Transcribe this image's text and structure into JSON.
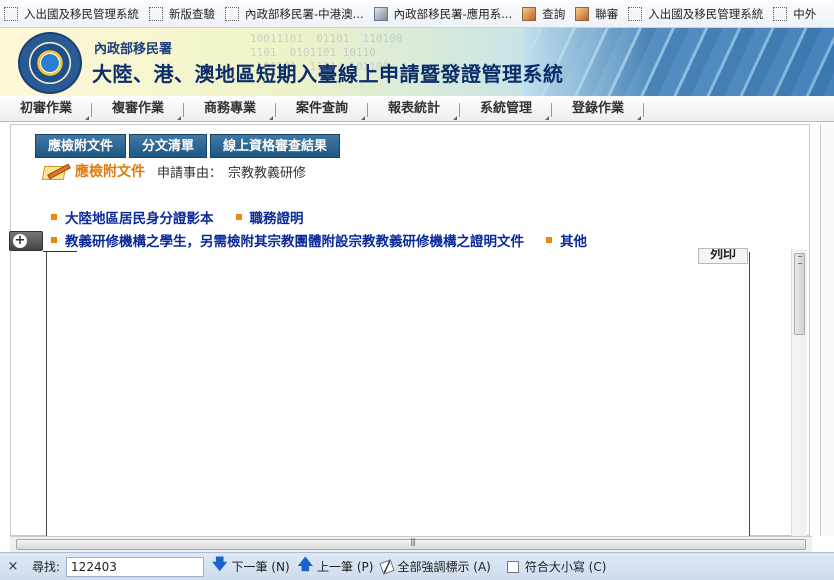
{
  "favorites": [
    {
      "label": "入出國及移民管理系統",
      "icon": "dotted-page-icon"
    },
    {
      "label": "新版查驗",
      "icon": "dotted-page-icon"
    },
    {
      "label": "內政部移民署-中港澳...",
      "icon": "dotted-page-icon"
    },
    {
      "label": "內政部移民署-應用系...",
      "icon": "app-image-icon"
    },
    {
      "label": "查詢",
      "icon": "app-image-icon"
    },
    {
      "label": "聯審",
      "icon": "app-image-icon"
    },
    {
      "label": "入出國及移民管理系統",
      "icon": "dotted-page-icon"
    },
    {
      "label": "中外",
      "icon": "dotted-page-icon"
    }
  ],
  "header": {
    "agency": "內政部移民署",
    "title": "大陸、港、澳地區短期入臺線上申請暨發證管理系統",
    "digits": "10011101  01101  110100\n1101  0101101 10110\n 101101  1101  101100"
  },
  "menu": [
    "初審作業",
    "複審作業",
    "商務專業",
    "案件查詢",
    "報表統計",
    "系統管理",
    "登錄作業"
  ],
  "tabs": [
    "應檢附文件",
    "分文清單",
    "線上資格審查結果"
  ],
  "request": {
    "title": "應檢附文件",
    "label": "申請事由：",
    "value": "宗教教義研修"
  },
  "documents": {
    "row1": [
      "大陸地區居民身分證影本",
      "職務證明"
    ],
    "row2": [
      "教義研修機構之學生，另需檢附其宗教團體附設宗教教義研修機構之證明文件",
      "其他"
    ]
  },
  "panel": {
    "print_label": "列印",
    "expand_label": "+"
  },
  "findbar": {
    "close": "×",
    "label": "尋找:",
    "value": "122403",
    "next": "下一筆 (N)",
    "prev": "上一筆 (P)",
    "highlight_all": "全部強調標示 (A)",
    "match_case": "符合大小寫 (C)"
  },
  "colors": {
    "tab_bg": "#1f5784",
    "doc_text": "#0b2a9a",
    "bullet": "#e88a10",
    "request_title": "#e07a10"
  }
}
